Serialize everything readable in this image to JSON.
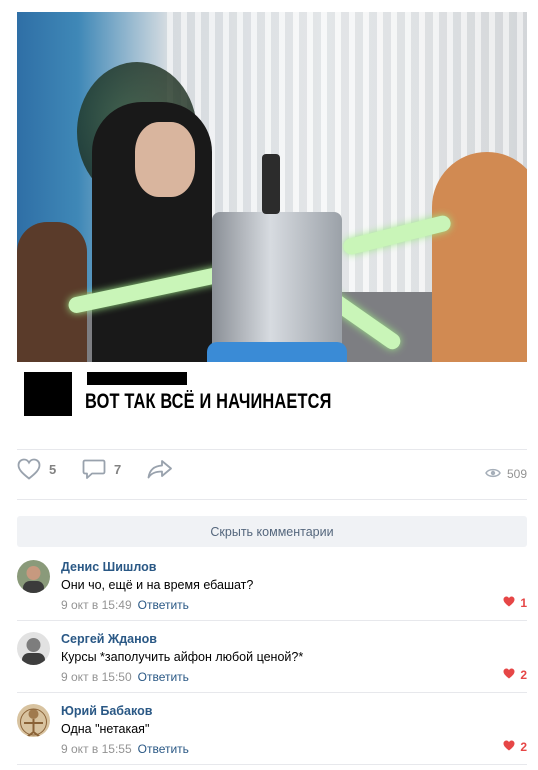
{
  "post": {
    "caption": "ВОТ ТАК ВСЁ И НАЧИНАЕТСЯ"
  },
  "actions": {
    "likes": "5",
    "comments": "7",
    "views": "509"
  },
  "hide_comments_label": "Скрыть комментарии",
  "comments": [
    {
      "author": "Денис Шишлов",
      "text": "Они чо, ещё и на время ебашат?",
      "time": "9 окт в 15:49",
      "reply": "Ответить",
      "likes": "1"
    },
    {
      "author": "Сергей Жданов",
      "text": "Курсы *заполучить айфон любой ценой?*",
      "time": "9 окт в 15:50",
      "reply": "Ответить",
      "likes": "2"
    },
    {
      "author": "Юрий Бабаков",
      "text": "Одна \"нетакая\"",
      "time": "9 окт в 15:55",
      "reply": "Ответить",
      "likes": "2"
    }
  ],
  "colors": {
    "link": "#2a5885",
    "like_red": "#e64646",
    "muted": "#939393",
    "button_bg": "#f0f2f5"
  }
}
